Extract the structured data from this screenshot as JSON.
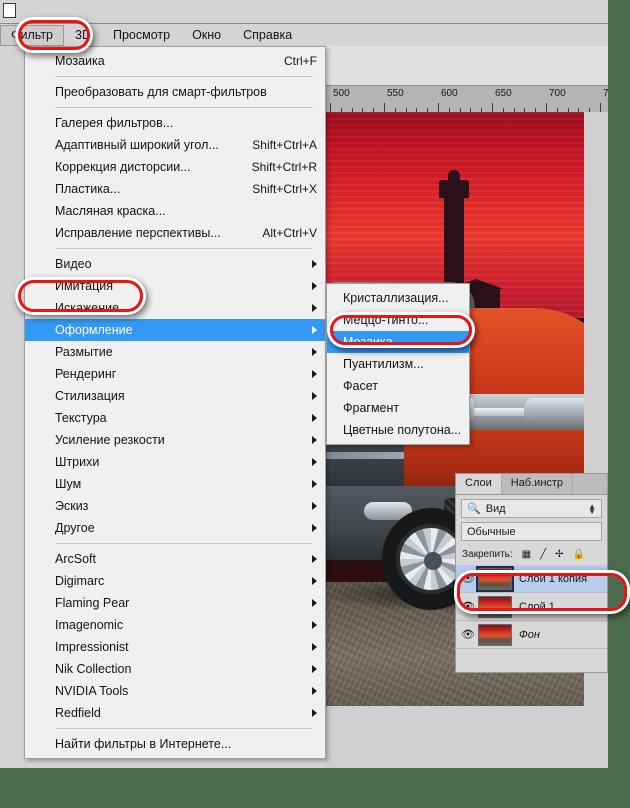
{
  "app": {
    "menubar": [
      {
        "label": "Фильтр",
        "accel": "Ф",
        "active": true
      },
      {
        "label": "3D",
        "accel": "3",
        "active": false
      },
      {
        "label": "Просмотр",
        "accel": "П",
        "active": false
      },
      {
        "label": "Окно",
        "accel": "О",
        "active": false
      },
      {
        "label": "Справка",
        "accel": "к",
        "active": false
      }
    ]
  },
  "ruler": {
    "labels": [
      "500",
      "550",
      "600",
      "650",
      "700",
      "7"
    ]
  },
  "filter_menu": {
    "groups": [
      {
        "items": [
          {
            "label": "Мозаика",
            "shortcut": "Ctrl+F",
            "submenu": false,
            "selected": false
          }
        ]
      },
      {
        "items": [
          {
            "label": "Преобразовать для смарт-фильтров",
            "shortcut": "",
            "submenu": false,
            "selected": false
          }
        ]
      },
      {
        "items": [
          {
            "label": "Галерея фильтров...",
            "shortcut": "",
            "submenu": false,
            "selected": false
          },
          {
            "label": "Адаптивный широкий угол...",
            "shortcut": "Shift+Ctrl+A",
            "submenu": false,
            "selected": false
          },
          {
            "label": "Коррекция дисторсии...",
            "shortcut": "Shift+Ctrl+R",
            "submenu": false,
            "selected": false
          },
          {
            "label": "Пластика...",
            "shortcut": "Shift+Ctrl+X",
            "submenu": false,
            "selected": false
          },
          {
            "label": "Масляная краска...",
            "shortcut": "",
            "submenu": false,
            "selected": false
          },
          {
            "label": "Исправление перспективы...",
            "shortcut": "Alt+Ctrl+V",
            "submenu": false,
            "selected": false
          }
        ]
      },
      {
        "items": [
          {
            "label": "Видео",
            "shortcut": "",
            "submenu": true,
            "selected": false
          },
          {
            "label": "Имитация",
            "shortcut": "",
            "submenu": true,
            "selected": false
          },
          {
            "label": "Искажение",
            "shortcut": "",
            "submenu": true,
            "selected": false
          },
          {
            "label": "Оформление",
            "shortcut": "",
            "submenu": true,
            "selected": true
          },
          {
            "label": "Размытие",
            "shortcut": "",
            "submenu": true,
            "selected": false
          },
          {
            "label": "Рендеринг",
            "shortcut": "",
            "submenu": true,
            "selected": false
          },
          {
            "label": "Стилизация",
            "shortcut": "",
            "submenu": true,
            "selected": false
          },
          {
            "label": "Текстура",
            "shortcut": "",
            "submenu": true,
            "selected": false
          },
          {
            "label": "Усиление резкости",
            "shortcut": "",
            "submenu": true,
            "selected": false
          },
          {
            "label": "Штрихи",
            "shortcut": "",
            "submenu": true,
            "selected": false
          },
          {
            "label": "Шум",
            "shortcut": "",
            "submenu": true,
            "selected": false
          },
          {
            "label": "Эскиз",
            "shortcut": "",
            "submenu": true,
            "selected": false
          },
          {
            "label": "Другое",
            "shortcut": "",
            "submenu": true,
            "selected": false
          }
        ]
      },
      {
        "items": [
          {
            "label": "ArcSoft",
            "shortcut": "",
            "submenu": true,
            "selected": false
          },
          {
            "label": "Digimarc",
            "shortcut": "",
            "submenu": true,
            "selected": false
          },
          {
            "label": "Flaming Pear",
            "shortcut": "",
            "submenu": true,
            "selected": false
          },
          {
            "label": "Imagenomic",
            "shortcut": "",
            "submenu": true,
            "selected": false
          },
          {
            "label": "Impressionist",
            "shortcut": "",
            "submenu": true,
            "selected": false
          },
          {
            "label": "Nik Collection",
            "shortcut": "",
            "submenu": true,
            "selected": false
          },
          {
            "label": "NVIDIA Tools",
            "shortcut": "",
            "submenu": true,
            "selected": false
          },
          {
            "label": "Redfield",
            "shortcut": "",
            "submenu": true,
            "selected": false
          }
        ]
      },
      {
        "items": [
          {
            "label": "Найти фильтры в Интернете...",
            "shortcut": "",
            "submenu": false,
            "selected": false
          }
        ]
      }
    ]
  },
  "submenu": {
    "title": "Оформление",
    "items": [
      {
        "label": "Кристаллизация...",
        "selected": false
      },
      {
        "label": "Меццо-тинто...",
        "selected": false
      },
      {
        "label": "Мозаика...",
        "selected": true
      },
      {
        "label": "Пуантилизм...",
        "selected": false
      },
      {
        "label": "Фасет",
        "selected": false
      },
      {
        "label": "Фрагмент",
        "selected": false
      },
      {
        "label": "Цветные полутона...",
        "selected": false
      }
    ]
  },
  "layers_panel": {
    "tabs": [
      {
        "label": "Слои",
        "active": true
      },
      {
        "label": "Наб.инстр",
        "active": false
      }
    ],
    "filter_value": "Вид",
    "blend_mode": "Обычные",
    "lock_label": "Закрепить:",
    "lock_icons": [
      "transparency-lock-icon",
      "brush-lock-icon",
      "move-lock-icon",
      "all-lock-icon"
    ],
    "layers": [
      {
        "name": "Слой 1 копия",
        "visible": true,
        "selected": true,
        "italic": false
      },
      {
        "name": "Слой 1",
        "visible": true,
        "selected": false,
        "italic": false
      },
      {
        "name": "Фон",
        "visible": true,
        "selected": false,
        "italic": true
      }
    ]
  },
  "colors": {
    "menu_highlight": "#3399f5",
    "annotation": "#e81515",
    "layer_selected": "#b8cdec",
    "window_chrome": "#d4d4d4",
    "desktop": "#4d6b4d"
  }
}
